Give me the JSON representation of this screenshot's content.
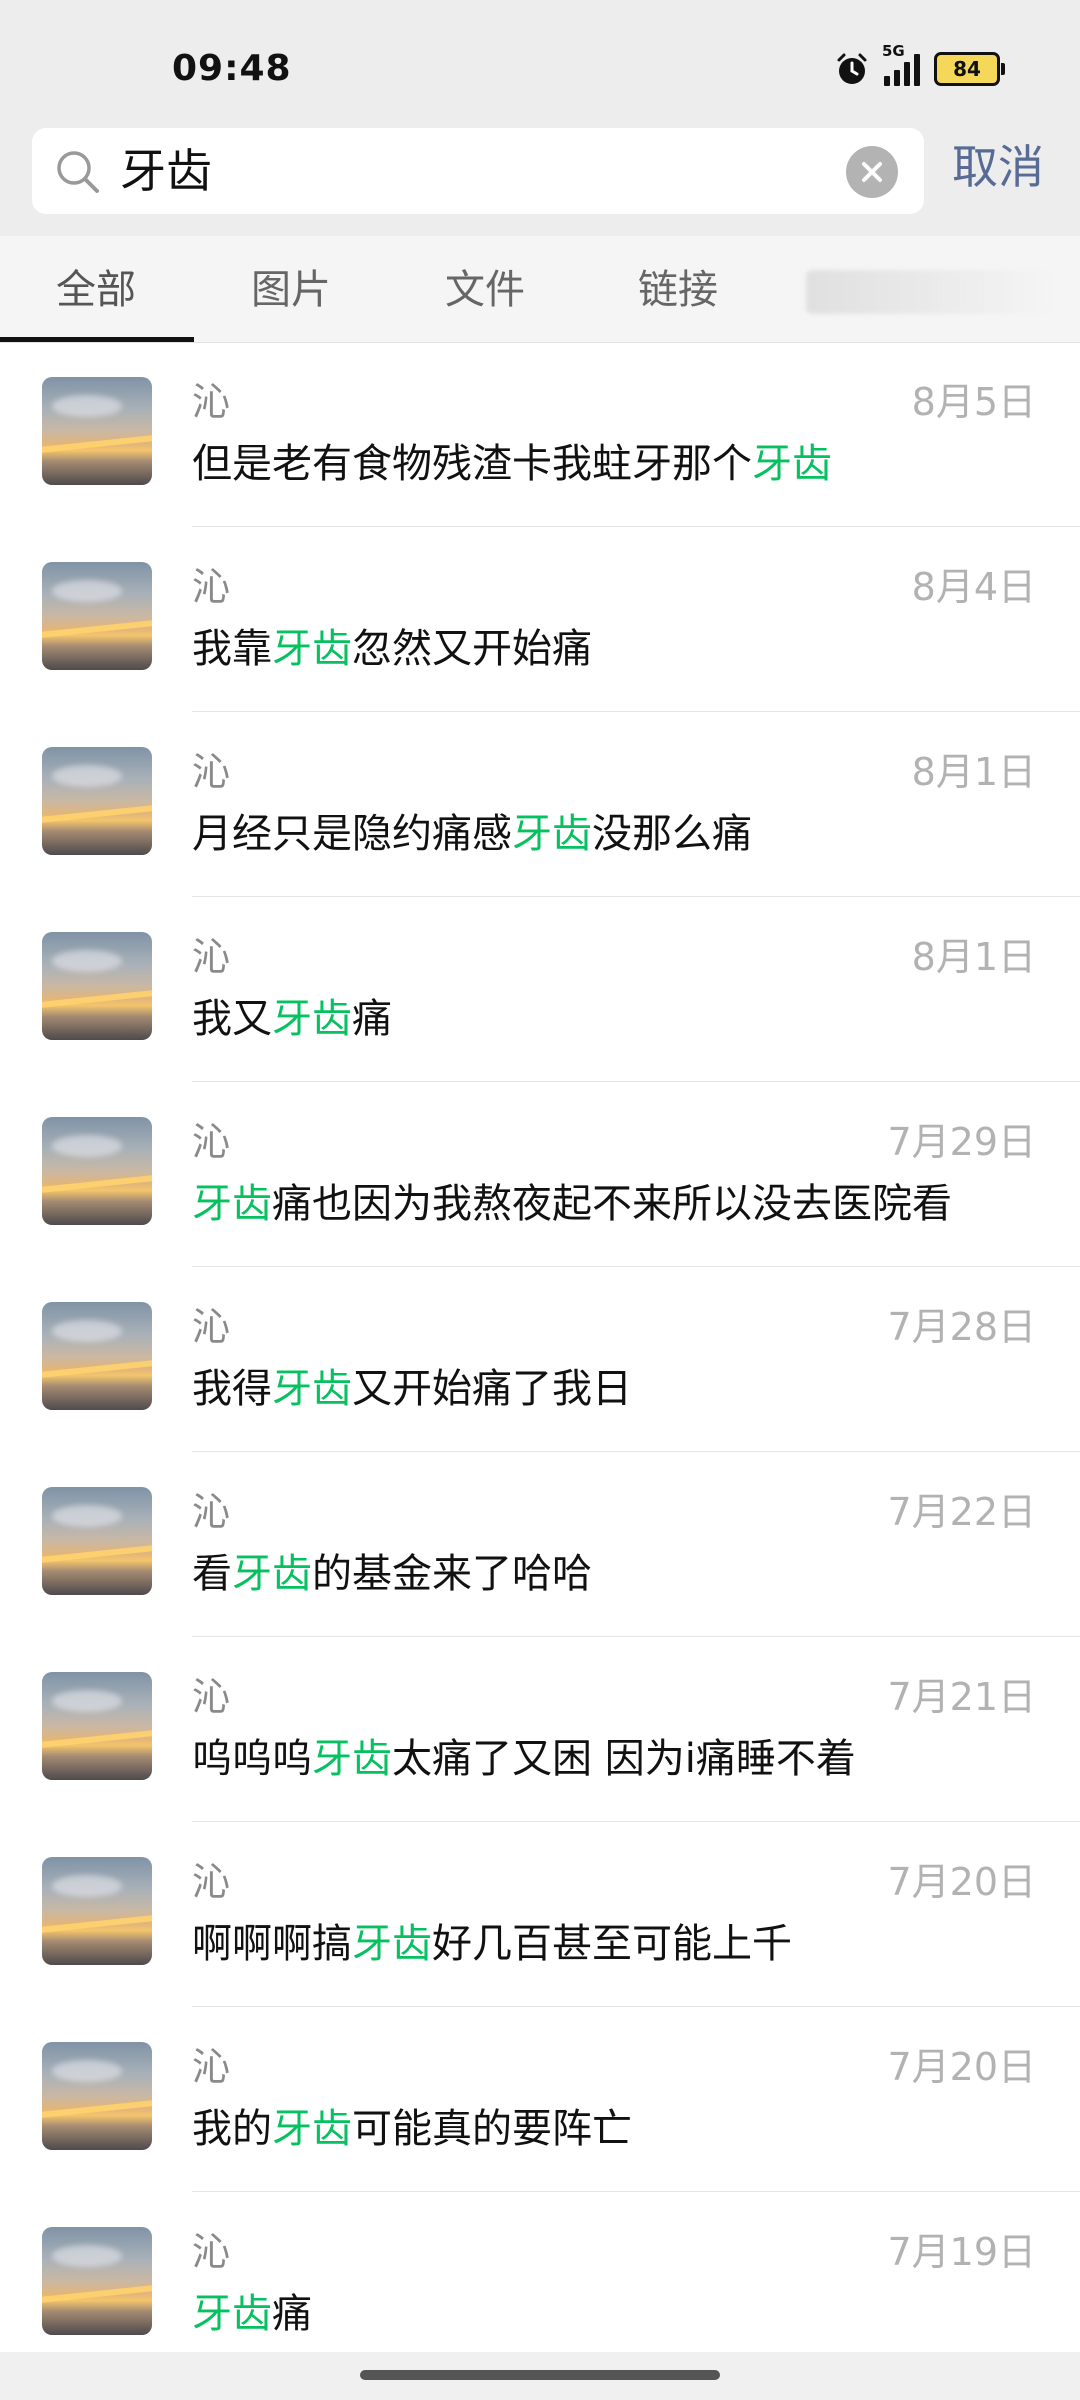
{
  "status_bar": {
    "time": "09:48",
    "network_label": "5G",
    "battery_level": "84",
    "icons": [
      "alarm-icon",
      "signal-icon",
      "battery-icon"
    ]
  },
  "search": {
    "query": "牙齿",
    "cancel_label": "取消",
    "icons": [
      "search-icon",
      "clear-icon"
    ]
  },
  "tabs": [
    {
      "label": "全部",
      "active": true
    },
    {
      "label": "图片",
      "active": false
    },
    {
      "label": "文件",
      "active": false
    },
    {
      "label": "链接",
      "active": false
    }
  ],
  "results": [
    {
      "sender": "沁",
      "date": "8月5日",
      "before": "但是老有食物残渣卡我蛀牙那个",
      "highlight": "牙齿",
      "after": ""
    },
    {
      "sender": "沁",
      "date": "8月4日",
      "before": "我靠",
      "highlight": "牙齿",
      "after": "忽然又开始痛"
    },
    {
      "sender": "沁",
      "date": "8月1日",
      "before": "月经只是隐约痛感",
      "highlight": "牙齿",
      "after": "没那么痛"
    },
    {
      "sender": "沁",
      "date": "8月1日",
      "before": "我又",
      "highlight": "牙齿",
      "after": "痛"
    },
    {
      "sender": "沁",
      "date": "7月29日",
      "before": "",
      "highlight": "牙齿",
      "after": "痛也因为我熬夜起不来所以没去医院看"
    },
    {
      "sender": "沁",
      "date": "7月28日",
      "before": "我得",
      "highlight": "牙齿",
      "after": "又开始痛了我日"
    },
    {
      "sender": "沁",
      "date": "7月22日",
      "before": "看",
      "highlight": "牙齿",
      "after": "的基金来了哈哈"
    },
    {
      "sender": "沁",
      "date": "7月21日",
      "before": "呜呜呜",
      "highlight": "牙齿",
      "after": "太痛了又困 因为i痛睡不着"
    },
    {
      "sender": "沁",
      "date": "7月20日",
      "before": "啊啊啊搞",
      "highlight": "牙齿",
      "after": "好几百甚至可能上千"
    },
    {
      "sender": "沁",
      "date": "7月20日",
      "before": "我的",
      "highlight": "牙齿",
      "after": "可能真的要阵亡"
    },
    {
      "sender": "沁",
      "date": "7月19日",
      "before": "",
      "highlight": "牙齿",
      "after": "痛"
    }
  ],
  "colors": {
    "highlight": "#07c160",
    "cancel": "#576b95",
    "header_bg": "#ededed"
  }
}
